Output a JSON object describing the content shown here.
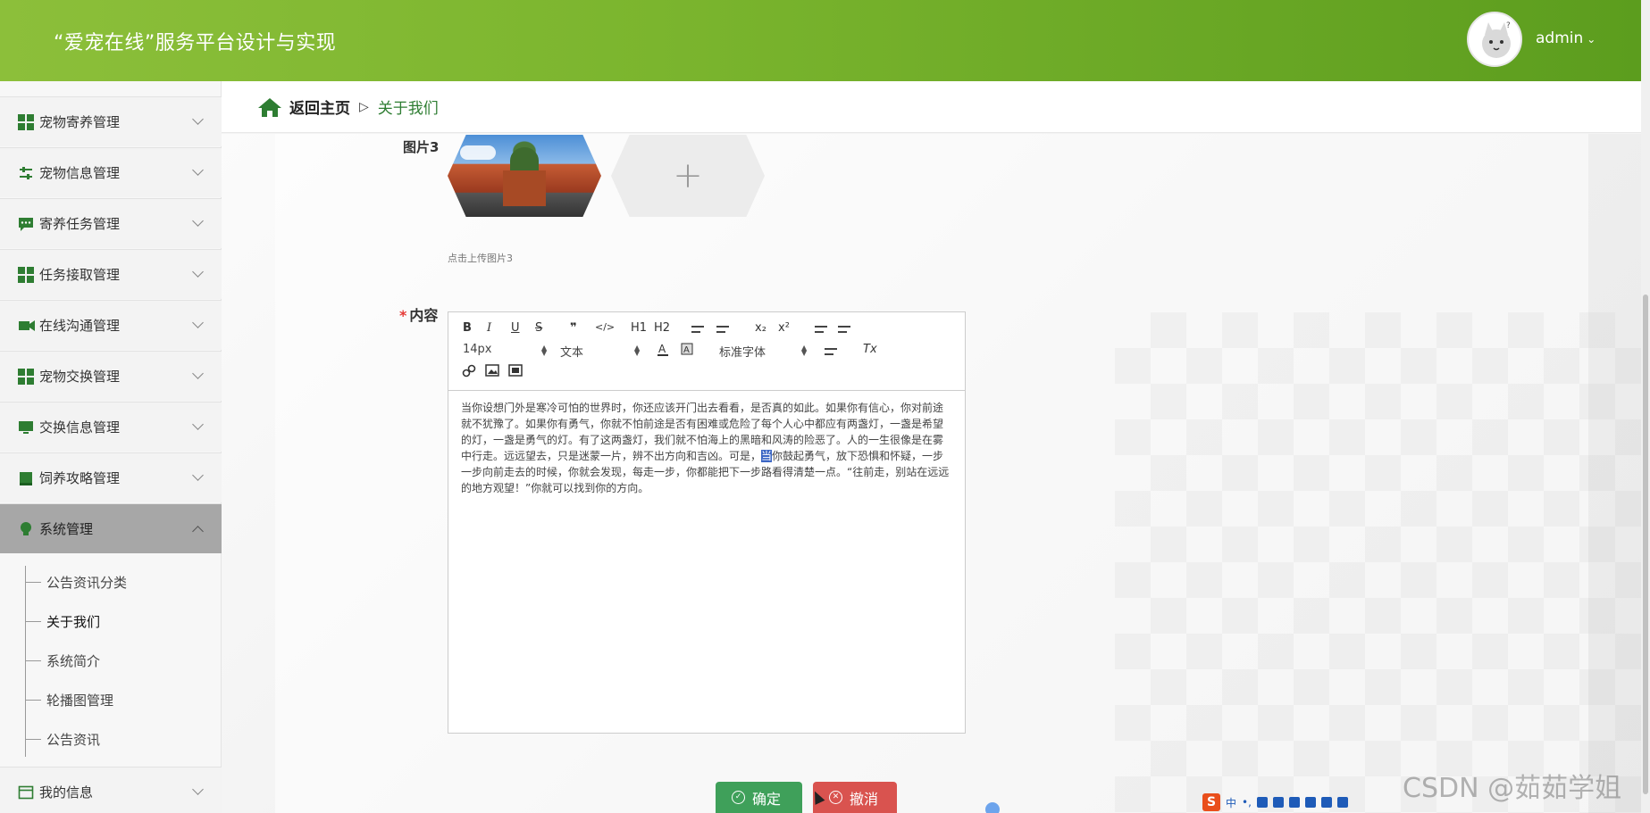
{
  "header": {
    "title": "“爱宠在线”服务平台设计与实现",
    "username": "admin"
  },
  "sidebar": {
    "items": [
      {
        "label": "宠物寄养管理",
        "icon": "grid-icon"
      },
      {
        "label": "宠物信息管理",
        "icon": "sliders-icon"
      },
      {
        "label": "寄养任务管理",
        "icon": "chat-icon"
      },
      {
        "label": "任务接取管理",
        "icon": "grid-icon"
      },
      {
        "label": "在线沟通管理",
        "icon": "video-icon"
      },
      {
        "label": "宠物交换管理",
        "icon": "grid-icon"
      },
      {
        "label": "交换信息管理",
        "icon": "monitor-icon"
      },
      {
        "label": "饲养攻略管理",
        "icon": "book-icon"
      },
      {
        "label": "系统管理",
        "icon": "bulb-icon",
        "expanded": true
      },
      {
        "label": "我的信息",
        "icon": "calendar-icon"
      }
    ],
    "subitems": [
      "公告资讯分类",
      "关于我们",
      "系统简介",
      "轮播图管理",
      "公告资讯"
    ],
    "current_subitem": "关于我们"
  },
  "breadcrumb": {
    "home": "返回主页",
    "separator": "▷",
    "current": "关于我们"
  },
  "form": {
    "picture3_label": "图片3",
    "upload_plus": "+",
    "upload_hint": "点击上传图片3",
    "content_label": "内容",
    "required_mark": "*",
    "toolbar": {
      "bold": "B",
      "italic": "I",
      "underline": "U",
      "strike": "S",
      "quote": "❞",
      "code": "</>",
      "h1": "H1",
      "h2": "H2",
      "sub": "x₂",
      "sup": "x²",
      "clean": "Tx",
      "font_size": "14px",
      "block_type": "文本",
      "font_family": "标准字体"
    },
    "content_before_selection": "当你设想门外是寒冷可怕的世界时，你还应该开门出去看看，是否真的如此。如果你有信心，你对前途就不犹豫了。如果你有勇气，你就不怕前途是否有困难或危险了每个人心中都应有两盏灯，一盏是希望的灯，一盏是勇气的灯。有了这两盏灯，我们就不怕海上的黑暗和风涛的险恶了。人的一生很像是在雾中行走。远远望去，只是迷蒙一片，辨不出方向和吉凶。可是，",
    "content_selected": "当",
    "content_after_selection": "你鼓起勇气，放下恐惧和怀疑，一步一步向前走去的时候，你就会发现，每走一步，你都能把下一步路看得清楚一点。“往前走，别站在远远的地方观望！”你就可以找到你的方向。",
    "confirm_button": "确定",
    "cancel_button": "撤消"
  },
  "taskbar": {
    "ime_logo": "S",
    "ime_mode": "中",
    "ime_punct": "•,"
  },
  "watermark": "CSDN @茹茹学姐",
  "colors": {
    "brand_green": "#7bb52e",
    "accent_green": "#2e7d32",
    "confirm": "#3fa05a",
    "cancel": "#d9534f"
  }
}
